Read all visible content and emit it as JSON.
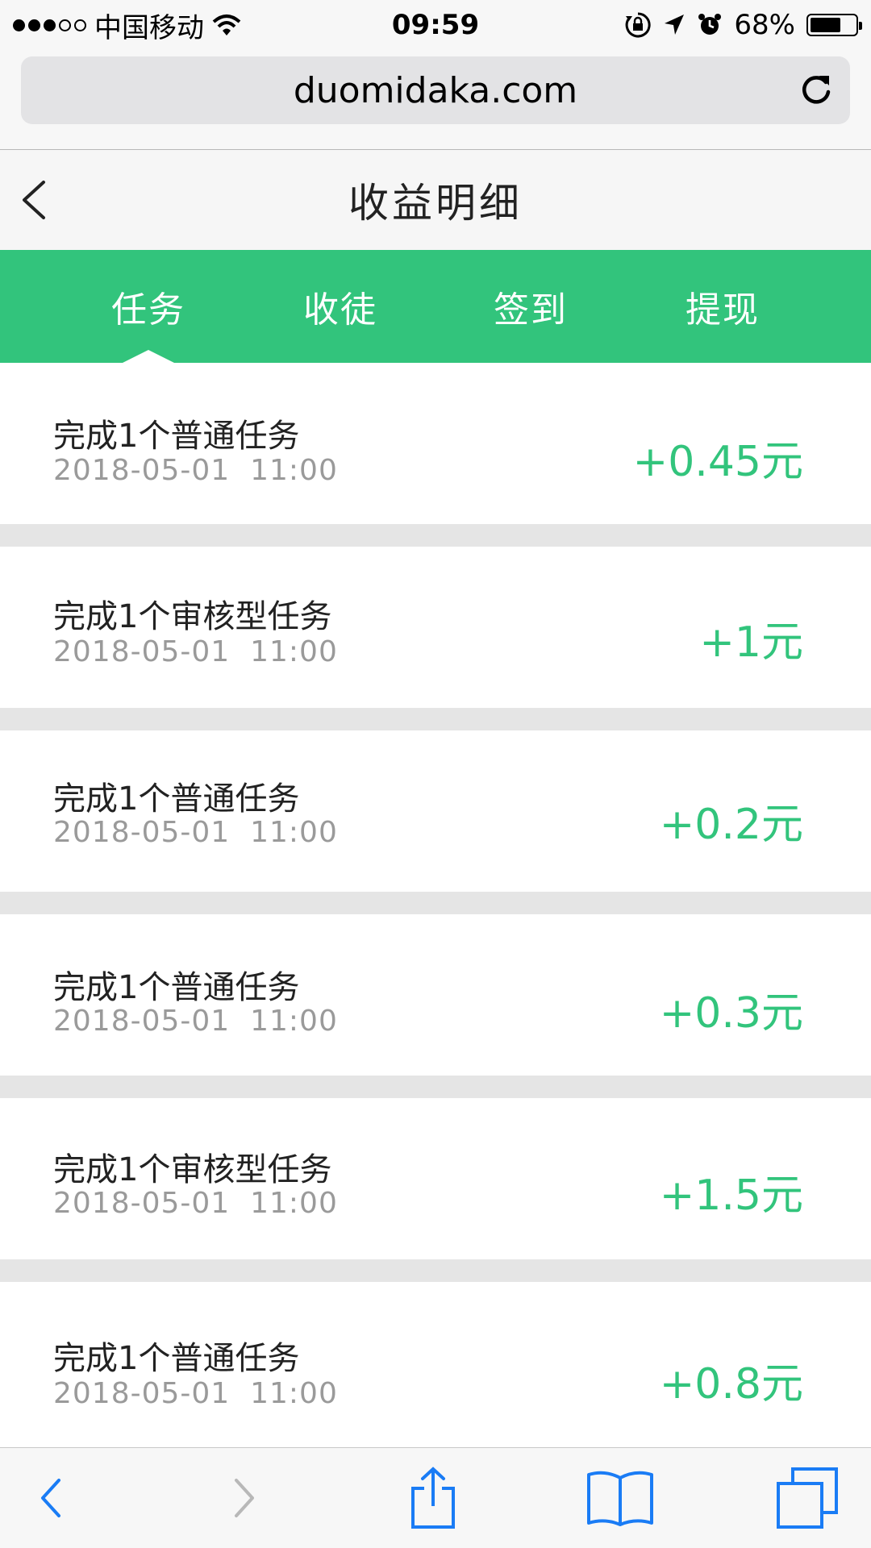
{
  "status_bar": {
    "carrier": "中国移动",
    "time": "09:59",
    "battery_percent": "68%",
    "battery_level": 0.68
  },
  "browser": {
    "url": "duomidaka.com"
  },
  "header": {
    "title": "收益明细"
  },
  "tabs": [
    {
      "label": "任务",
      "active": true
    },
    {
      "label": "收徒",
      "active": false
    },
    {
      "label": "签到",
      "active": false
    },
    {
      "label": "提现",
      "active": false
    }
  ],
  "records": [
    {
      "title": "完成1个普通任务",
      "time": "2018-05-01  11:00",
      "amount": "+0.45元"
    },
    {
      "title": "完成1个审核型任务",
      "time": "2018-05-01  11:00",
      "amount": "+1元"
    },
    {
      "title": "完成1个普通任务",
      "time": "2018-05-01  11:00",
      "amount": "+0.2元"
    },
    {
      "title": "完成1个普通任务",
      "time": "2018-05-01  11:00",
      "amount": "+0.3元"
    },
    {
      "title": "完成1个审核型任务",
      "time": "2018-05-01  11:00",
      "amount": "+1.5元"
    },
    {
      "title": "完成1个普通任务",
      "time": "2018-05-01  11:00",
      "amount": "+0.8元"
    }
  ],
  "colors": {
    "accent": "#32c47c",
    "ios_blue": "#1a7cf5"
  },
  "icons": {
    "back": "chevron-left-icon",
    "reload": "reload-icon",
    "wifi": "wifi-icon",
    "lock_rotation": "rotation-lock-icon",
    "location": "location-arrow-icon",
    "alarm": "alarm-icon",
    "share": "share-icon",
    "bookmarks": "book-icon",
    "tabs": "tabs-icon"
  }
}
